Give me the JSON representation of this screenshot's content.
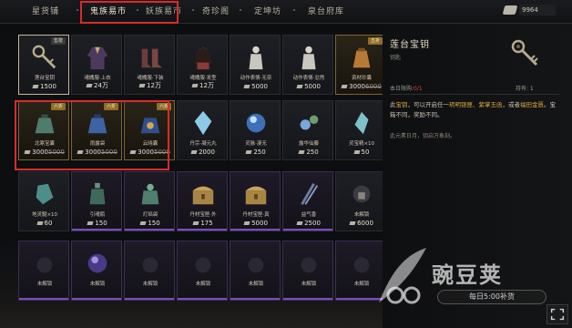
{
  "topnav": {
    "tabs": [
      {
        "label": "星货铺"
      },
      {
        "label": "鬼族易市"
      },
      {
        "label": "妖族易市"
      },
      {
        "label": "奇珍阁"
      },
      {
        "label": "定坤坊"
      },
      {
        "label": "泉台府库"
      }
    ],
    "currency_value": "9964"
  },
  "items": [
    {
      "name": "莲台宝钥",
      "price": "1500",
      "old_price": "",
      "tag": "售罄",
      "art": "key",
      "style": "selected"
    },
    {
      "name": "魂魄服·上衣",
      "price": "24万",
      "old_price": "",
      "tag": "",
      "art": "robe",
      "style": ""
    },
    {
      "name": "魂魄服·下装",
      "price": "12万",
      "old_price": "",
      "tag": "",
      "art": "boots",
      "style": ""
    },
    {
      "name": "魂魄服·发型",
      "price": "12万",
      "old_price": "",
      "tag": "",
      "art": "hair",
      "style": ""
    },
    {
      "name": "动作表情·无奈",
      "price": "5000",
      "old_price": "",
      "tag": "",
      "art": "statue",
      "style": ""
    },
    {
      "name": "动作表情·忿然",
      "price": "5000",
      "old_price": "",
      "tag": "",
      "art": "statue",
      "style": ""
    },
    {
      "name": "资材珍囊",
      "price": "3000",
      "old_price": "6000",
      "tag": "五折",
      "art": "bag",
      "style": "gold"
    },
    {
      "name": "北寒宝囊",
      "price": "3000",
      "old_price": "5000",
      "tag": "六折",
      "art": "bag2",
      "style": "gold"
    },
    {
      "name": "雨露袋",
      "price": "3000",
      "old_price": "5000",
      "tag": "六折",
      "art": "bag3",
      "style": "gold"
    },
    {
      "name": "云晓囊",
      "price": "3000",
      "old_price": "5000",
      "tag": "六折",
      "art": "bag4",
      "style": "gold"
    },
    {
      "name": "丹宗·凝元丸",
      "price": "2000",
      "old_price": "",
      "tag": "",
      "art": "crystal",
      "style": ""
    },
    {
      "name": "灵脉·凄无",
      "price": "250",
      "old_price": "",
      "tag": "",
      "art": "orb",
      "style": ""
    },
    {
      "name": "露华仙藤",
      "price": "250",
      "old_price": "",
      "tag": "",
      "art": "vine",
      "style": ""
    },
    {
      "name": "灵宝精×10",
      "price": "50",
      "old_price": "",
      "tag": "",
      "art": "crystal2",
      "style": ""
    },
    {
      "name": "地灵髓×10",
      "price": "60",
      "old_price": "",
      "tag": "",
      "art": "gem",
      "style": ""
    },
    {
      "name": "引魂瓶",
      "price": "150",
      "old_price": "",
      "tag": "",
      "art": "bottle",
      "style": "purple"
    },
    {
      "name": "灯焰袋",
      "price": "150",
      "old_price": "",
      "tag": "",
      "art": "pouch",
      "style": "purple"
    },
    {
      "name": "丹材宝匣·外",
      "price": "175",
      "old_price": "",
      "tag": "",
      "art": "chest",
      "style": "purple"
    },
    {
      "name": "丹材宝匣·真",
      "price": "5000",
      "old_price": "",
      "tag": "",
      "art": "chest",
      "style": "purple"
    },
    {
      "name": "益气香",
      "price": "2500",
      "old_price": "",
      "tag": "",
      "art": "sticks",
      "style": "purple"
    },
    {
      "name": "未解锁",
      "price": "6000",
      "old_price": "",
      "tag": "",
      "art": "locked",
      "style": ""
    },
    {
      "name": "未解锁",
      "price": "",
      "old_price": "",
      "tag": "",
      "art": "dark",
      "style": "purple"
    },
    {
      "name": "未解锁",
      "price": "",
      "old_price": "",
      "tag": "",
      "art": "orbp",
      "style": "purple"
    },
    {
      "name": "未解锁",
      "price": "",
      "old_price": "",
      "tag": "",
      "art": "dark",
      "style": "purple"
    },
    {
      "name": "未解锁",
      "price": "",
      "old_price": "",
      "tag": "",
      "art": "dark",
      "style": "purple"
    },
    {
      "name": "未解锁",
      "price": "",
      "old_price": "",
      "tag": "",
      "art": "dark",
      "style": "purple"
    },
    {
      "name": "未解锁",
      "price": "",
      "old_price": "",
      "tag": "",
      "art": "dark",
      "style": "purple"
    },
    {
      "name": "未解锁",
      "price": "",
      "old_price": "",
      "tag": "",
      "art": "dark",
      "style": "purple"
    }
  ],
  "panel": {
    "title": "莲台宝钥",
    "subtitle": "钥匙",
    "limit_label": "本日限购:",
    "limit_value": "0/1",
    "own_label": "持有: 1",
    "desc_prefix": "此",
    "desc_hl1": "宝钥",
    "desc_mid": "，可以开启任一",
    "desc_hl2": "玥明银匣、紫掌玉函",
    "desc_mid2": "，或者",
    "desc_hl3": "福田金匮",
    "desc_end": "。宝箱不同，奖励不同。",
    "note": "此元素日月，钥启万象刻。"
  },
  "watermark": {
    "brand": "豌豆荚",
    "slogan": "每日5:00补货"
  }
}
